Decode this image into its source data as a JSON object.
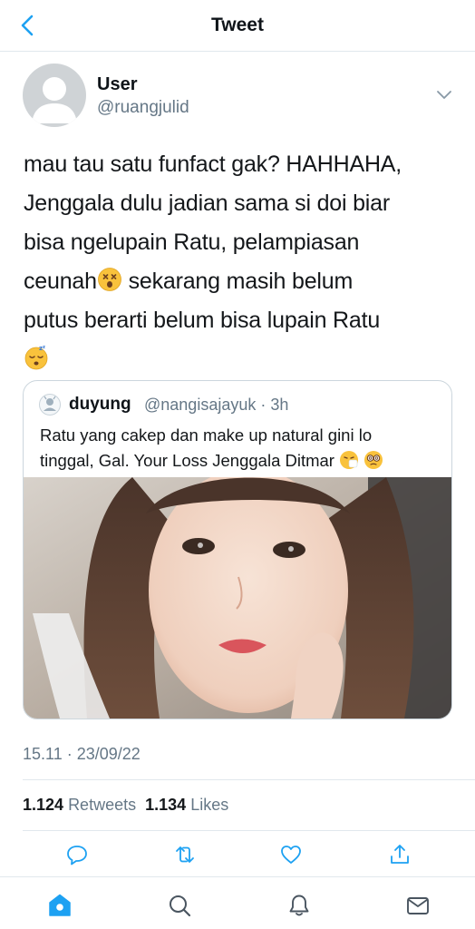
{
  "header": {
    "title": "Tweet"
  },
  "author": {
    "name": "User",
    "handle": "@ruangjulid"
  },
  "tweet": {
    "line1": "mau tau satu funfact gak? HAHHAHA,",
    "line2": "Jenggala dulu jadian sama si doi biar",
    "line3": "bisa ngelupain Ratu, pelampiasan",
    "line4a": "ceunah",
    "line4b": " sekarang masih belum",
    "line5": "putus berarti belum bisa lupain Ratu",
    "emoji1": "dizzy-face-emoji",
    "emoji2": "sleeping-face-emoji"
  },
  "quote": {
    "name": "duyung",
    "handle": "@nangisajayuk",
    "time": "3h",
    "separator": "·",
    "line1": "Ratu yang cakep dan make up natural gini lo",
    "line2": "tinggal, Gal. Your Loss Jenggala Ditmar",
    "emojis": [
      "sneezing-face-emoji",
      "dizzy-eyes-emoji"
    ]
  },
  "timestamp": "15.11 · 23/09/22",
  "stats": {
    "retweets_count": "1.124",
    "retweets_label": "Retweets",
    "likes_count": "1.134",
    "likes_label": "Likes"
  },
  "actions": [
    "reply-icon",
    "retweet-icon",
    "like-icon",
    "share-icon"
  ],
  "tabs": [
    "home-icon",
    "search-icon",
    "notifications-icon",
    "messages-icon"
  ],
  "colors": {
    "accent": "#1da1f2",
    "muted": "#657786",
    "divider": "#e1e8ed"
  }
}
